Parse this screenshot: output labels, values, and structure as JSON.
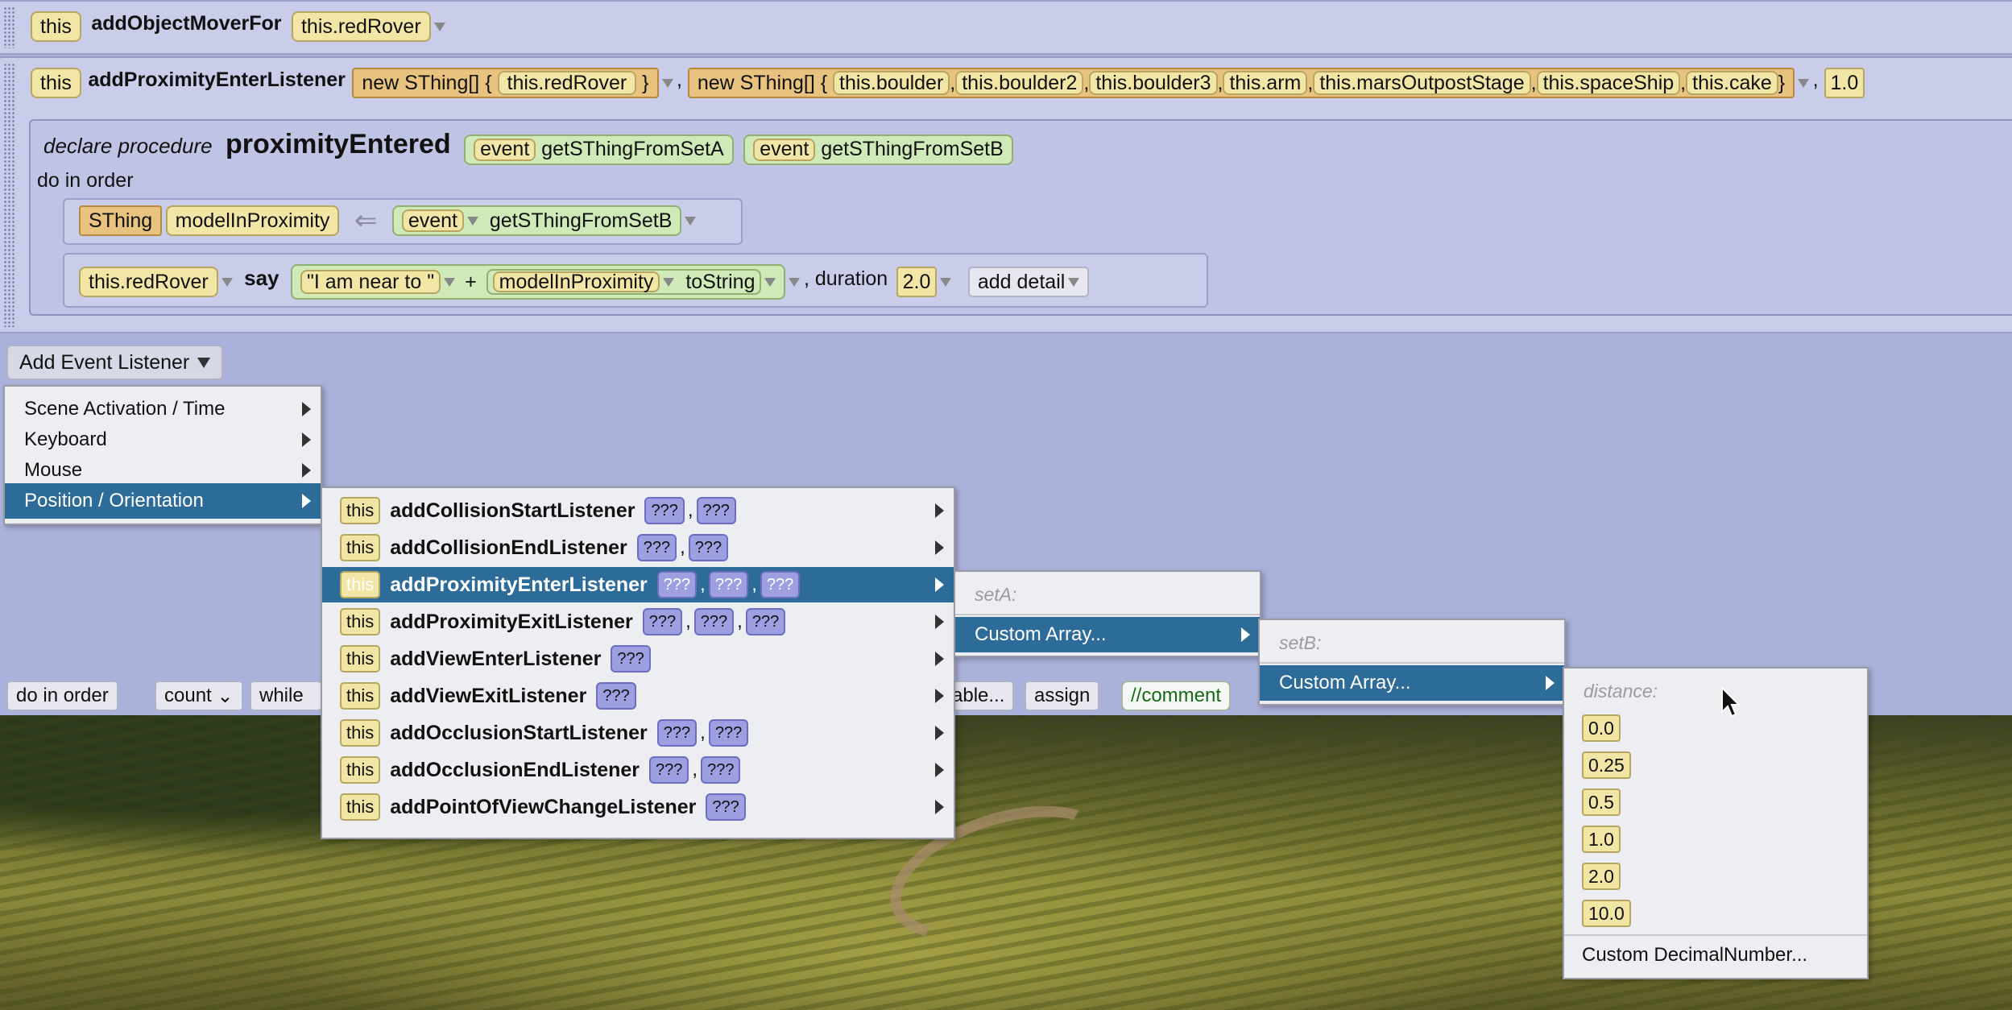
{
  "row1": {
    "this_label": "this",
    "method": "addObjectMoverFor",
    "arg": "this.redRover"
  },
  "row2": {
    "this_label": "this",
    "method": "addProximityEnterListener",
    "setA_prefix": "new SThing[] {",
    "setA_items": [
      "this.redRover"
    ],
    "close": "}",
    "setB_prefix": "new SThing[] {",
    "setB_items": [
      "this.boulder",
      "this.boulder2",
      "this.boulder3",
      "this.arm",
      "this.marsOutpostStage",
      "this.spaceShip",
      "this.cake"
    ],
    "distance": "1.0"
  },
  "procedure": {
    "declare": "declare procedure",
    "name": "proximityEntered",
    "params": [
      {
        "event": "event",
        "name": "getSThingFromSetA"
      },
      {
        "event": "event",
        "name": "getSThingFromSetB"
      }
    ],
    "do_in_order": "do in order",
    "stmt1": {
      "type": "SThing",
      "var": "modelInProximity",
      "event": "event",
      "getter": "getSThingFromSetB"
    },
    "stmt2": {
      "target": "this.redRover",
      "say": "say",
      "text": "\"I am near to \"",
      "plus": "+",
      "var": "modelInProximity",
      "tostring": "toString",
      "duration_label": "duration",
      "duration": "2.0",
      "add_detail": "add detail"
    }
  },
  "add_event_listener": "Add Event Listener",
  "bottom_bar": {
    "do_in_order": "do in order",
    "count": "count",
    "while": "while",
    "variable": "able...",
    "assign": "assign",
    "comment": "//comment"
  },
  "menu1": [
    "Scene Activation / Time",
    "Keyboard",
    "Mouse",
    "Position / Orientation"
  ],
  "menu2": [
    {
      "name": "addCollisionStartListener",
      "args": [
        "???",
        "???"
      ]
    },
    {
      "name": "addCollisionEndListener",
      "args": [
        "???",
        "???"
      ]
    },
    {
      "name": "addProximityEnterListener",
      "args": [
        "???",
        "???",
        "???"
      ]
    },
    {
      "name": "addProximityExitListener",
      "args": [
        "???",
        "???",
        "???"
      ]
    },
    {
      "name": "addViewEnterListener",
      "args": [
        "???"
      ]
    },
    {
      "name": "addViewExitListener",
      "args": [
        "???"
      ]
    },
    {
      "name": "addOcclusionStartListener",
      "args": [
        "???",
        "???"
      ]
    },
    {
      "name": "addOcclusionEndListener",
      "args": [
        "???",
        "???"
      ]
    },
    {
      "name": "addPointOfViewChangeListener",
      "args": [
        "???"
      ]
    }
  ],
  "menu3": {
    "header": "setA:",
    "item": "Custom Array..."
  },
  "menu4": {
    "header": "setB:",
    "item": "Custom Array..."
  },
  "menu5": {
    "header": "distance:",
    "values": [
      "0.0",
      "0.25",
      "0.5",
      "1.0",
      "2.0",
      "10.0"
    ],
    "custom": "Custom DecimalNumber..."
  },
  "colors": {
    "menu_selected": "#2d6b98",
    "panel": "#aab1da",
    "row": "#c9cdea",
    "purple": "#9d9fe0"
  }
}
